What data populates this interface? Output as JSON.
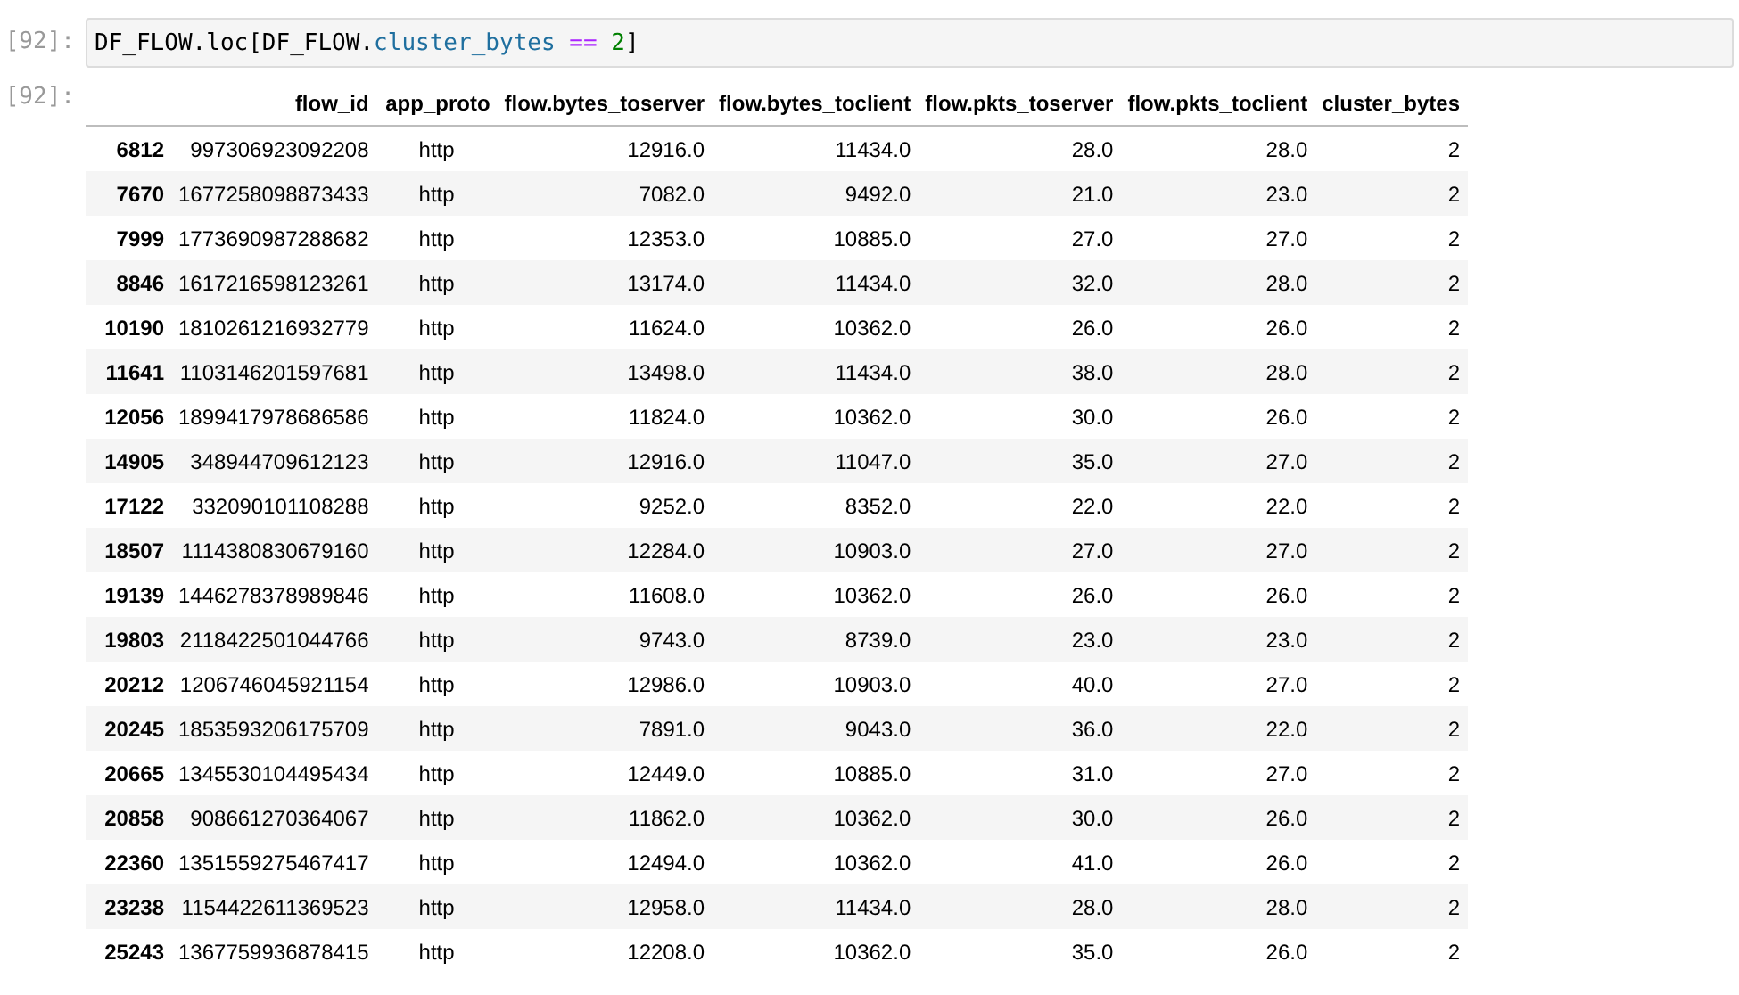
{
  "input_cell": {
    "prompt": "[92]:",
    "code": [
      {
        "kind": "plain",
        "text": "DF_FLOW.loc[DF_FLOW."
      },
      {
        "kind": "attr",
        "text": "cluster_bytes"
      },
      {
        "kind": "operator",
        "text": " == "
      },
      {
        "kind": "number",
        "text": "2"
      },
      {
        "kind": "plain",
        "text": "]"
      }
    ]
  },
  "output_cell": {
    "prompt": "[92]:",
    "table": {
      "columns": [
        "flow_id",
        "app_proto",
        "flow.bytes_toserver",
        "flow.bytes_toclient",
        "flow.pkts_toserver",
        "flow.pkts_toclient",
        "cluster_bytes"
      ],
      "rows": [
        {
          "index": "6812",
          "cells": [
            "997306923092208",
            "http",
            "12916.0",
            "11434.0",
            "28.0",
            "28.0",
            "2"
          ]
        },
        {
          "index": "7670",
          "cells": [
            "1677258098873433",
            "http",
            "7082.0",
            "9492.0",
            "21.0",
            "23.0",
            "2"
          ]
        },
        {
          "index": "7999",
          "cells": [
            "1773690987288682",
            "http",
            "12353.0",
            "10885.0",
            "27.0",
            "27.0",
            "2"
          ]
        },
        {
          "index": "8846",
          "cells": [
            "1617216598123261",
            "http",
            "13174.0",
            "11434.0",
            "32.0",
            "28.0",
            "2"
          ]
        },
        {
          "index": "10190",
          "cells": [
            "1810261216932779",
            "http",
            "11624.0",
            "10362.0",
            "26.0",
            "26.0",
            "2"
          ]
        },
        {
          "index": "11641",
          "cells": [
            "1103146201597681",
            "http",
            "13498.0",
            "11434.0",
            "38.0",
            "28.0",
            "2"
          ]
        },
        {
          "index": "12056",
          "cells": [
            "1899417978686586",
            "http",
            "11824.0",
            "10362.0",
            "30.0",
            "26.0",
            "2"
          ]
        },
        {
          "index": "14905",
          "cells": [
            "348944709612123",
            "http",
            "12916.0",
            "11047.0",
            "35.0",
            "27.0",
            "2"
          ]
        },
        {
          "index": "17122",
          "cells": [
            "332090101108288",
            "http",
            "9252.0",
            "8352.0",
            "22.0",
            "22.0",
            "2"
          ]
        },
        {
          "index": "18507",
          "cells": [
            "1114380830679160",
            "http",
            "12284.0",
            "10903.0",
            "27.0",
            "27.0",
            "2"
          ]
        },
        {
          "index": "19139",
          "cells": [
            "1446278378989846",
            "http",
            "11608.0",
            "10362.0",
            "26.0",
            "26.0",
            "2"
          ]
        },
        {
          "index": "19803",
          "cells": [
            "2118422501044766",
            "http",
            "9743.0",
            "8739.0",
            "23.0",
            "23.0",
            "2"
          ]
        },
        {
          "index": "20212",
          "cells": [
            "1206746045921154",
            "http",
            "12986.0",
            "10903.0",
            "40.0",
            "27.0",
            "2"
          ]
        },
        {
          "index": "20245",
          "cells": [
            "1853593206175709",
            "http",
            "7891.0",
            "9043.0",
            "36.0",
            "22.0",
            "2"
          ]
        },
        {
          "index": "20665",
          "cells": [
            "1345530104495434",
            "http",
            "12449.0",
            "10885.0",
            "31.0",
            "27.0",
            "2"
          ]
        },
        {
          "index": "20858",
          "cells": [
            "908661270364067",
            "http",
            "11862.0",
            "10362.0",
            "30.0",
            "26.0",
            "2"
          ]
        },
        {
          "index": "22360",
          "cells": [
            "1351559275467417",
            "http",
            "12494.0",
            "10362.0",
            "41.0",
            "26.0",
            "2"
          ]
        },
        {
          "index": "23238",
          "cells": [
            "1154422611369523",
            "http",
            "12958.0",
            "11434.0",
            "28.0",
            "28.0",
            "2"
          ]
        },
        {
          "index": "25243",
          "cells": [
            "1367759936878415",
            "http",
            "12208.0",
            "10362.0",
            "35.0",
            "26.0",
            "2"
          ]
        }
      ]
    }
  }
}
